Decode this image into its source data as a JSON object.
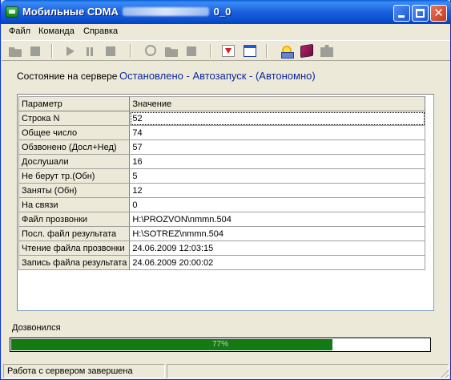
{
  "window": {
    "title_prefix": "Мобильные CDMA",
    "title_suffix": "0_0"
  },
  "menu": [
    "Файл",
    "Команда",
    "Справка"
  ],
  "toolbar_icons": [
    "open-folder-icon",
    "stop-icon",
    "play-icon",
    "pause-icon",
    "stop-icon",
    "clock-icon",
    "open-folder-icon",
    "stop-icon",
    "import-icon",
    "window-icon",
    "settings-icon",
    "book-icon",
    "puzzle-icon"
  ],
  "server": {
    "state_label": "Состояние на сервере",
    "state_value": "Остановлено - Автозапуск - (Автономно)"
  },
  "grid": {
    "headers": [
      "Параметр",
      "Значение"
    ],
    "rows": [
      {
        "param": "Строка N",
        "value": "52"
      },
      {
        "param": "Общее число",
        "value": "74"
      },
      {
        "param": "Обзвонено (Досл+Нед)",
        "value": "57"
      },
      {
        "param": "Дослушали",
        "value": "16"
      },
      {
        "param": "Не берут тр.(Обн)",
        "value": "5"
      },
      {
        "param": "Заняты (Обн)",
        "value": "12"
      },
      {
        "param": "На связи",
        "value": "0"
      },
      {
        "param": "Файл прозвонки",
        "value": "H:\\PROZVON\\nmmn.504"
      },
      {
        "param": "Посл. файл результата",
        "value": "H:\\SOTREZ\\nmmn.504"
      },
      {
        "param": "Чтение файла прозвонки",
        "value": "24.06.2009 12:03:15"
      },
      {
        "param": "Запись файла результата",
        "value": "24.06.2009 20:00:02"
      }
    ]
  },
  "progress": {
    "label": "Дозвонился",
    "percent": 77,
    "text": "77%",
    "color": "#147b14"
  },
  "status": {
    "text": "Работа с сервером завершена"
  }
}
